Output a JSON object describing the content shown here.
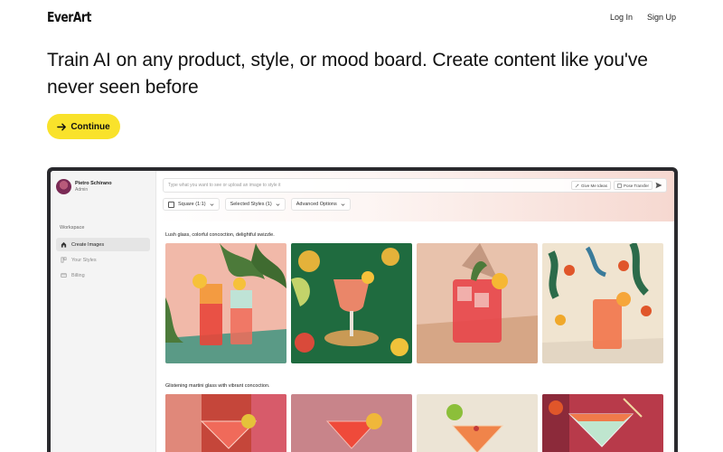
{
  "brand": {
    "logo": "EverArt"
  },
  "nav": {
    "login": "Log In",
    "signup": "Sign Up"
  },
  "hero": {
    "title": "Train AI on any product, style, or mood board. Create content like you've never seen before",
    "cta_label": "Continue"
  },
  "app": {
    "profile": {
      "name": "Pietro Schirano",
      "role": "Admin"
    },
    "sidebar": {
      "section_label": "Workspace",
      "items": [
        {
          "label": "Create Images",
          "icon": "home-icon",
          "active": true
        },
        {
          "label": "Your Styles",
          "icon": "styles-icon",
          "active": false
        },
        {
          "label": "Billing",
          "icon": "card-icon",
          "active": false
        }
      ]
    },
    "prompt": {
      "placeholder": "Type what you want to see or upload an image to style it",
      "give_ideas": "Give Me Ideas",
      "pose_transfer": "Pose Transfer"
    },
    "options": {
      "aspect": "Square (1:1)",
      "styles": "Selected Styles (1)",
      "advanced": "Advanced Options"
    },
    "groups": [
      {
        "title": "Lush glass, colorful concoction, delightful swizzle."
      },
      {
        "title": "Glistening martini glass with vibrant concoction."
      }
    ]
  },
  "colors": {
    "accent": "#f9e22b",
    "frame": "#2a2a2e",
    "sidebar": "#f4f4f4"
  }
}
